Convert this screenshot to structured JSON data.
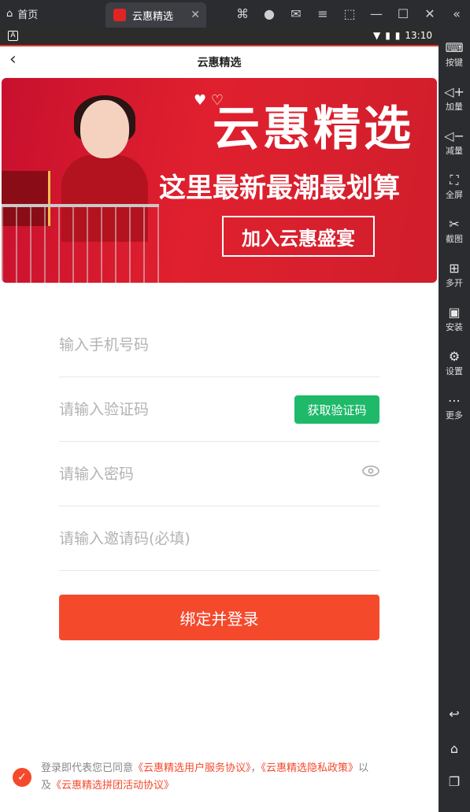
{
  "window": {
    "home_tab": "首页",
    "active_tab": "云惠精选"
  },
  "status": {
    "time": "13:10",
    "left_icon": "A"
  },
  "navbar": {
    "title": "云惠精选"
  },
  "banner": {
    "title": "云惠精选",
    "subtitle": "这里最新最潮最划算",
    "button": "加入云惠盛宴"
  },
  "form": {
    "phone_placeholder": "输入手机号码",
    "code_placeholder": "请输入验证码",
    "code_button": "获取验证码",
    "password_placeholder": "请输入密码",
    "invite_placeholder": "请输入邀请码(必填)",
    "submit": "绑定并登录"
  },
  "agreement": {
    "prefix": "登录即代表您已同意",
    "link1": "《云惠精选用户服务协议》",
    "sep": "，",
    "link2": "《云惠精选隐私政策》",
    "and1": "以",
    "and2": "及",
    "link3": "《云惠精选拼团活动协议》"
  },
  "sidebar": {
    "items": [
      {
        "label": "按键",
        "icon": "keyboard-icon"
      },
      {
        "label": "加量",
        "icon": "volume-up-icon"
      },
      {
        "label": "减量",
        "icon": "volume-down-icon"
      },
      {
        "label": "全屏",
        "icon": "fullscreen-icon"
      },
      {
        "label": "截图",
        "icon": "scissors-icon"
      },
      {
        "label": "多开",
        "icon": "multi-open-icon"
      },
      {
        "label": "安装",
        "icon": "apk-icon"
      },
      {
        "label": "设置",
        "icon": "gear-icon"
      },
      {
        "label": "更多",
        "icon": "more-icon"
      }
    ]
  },
  "colors": {
    "accent": "#f5492c",
    "green": "#1fb96a",
    "banner_red": "#d8202e"
  }
}
